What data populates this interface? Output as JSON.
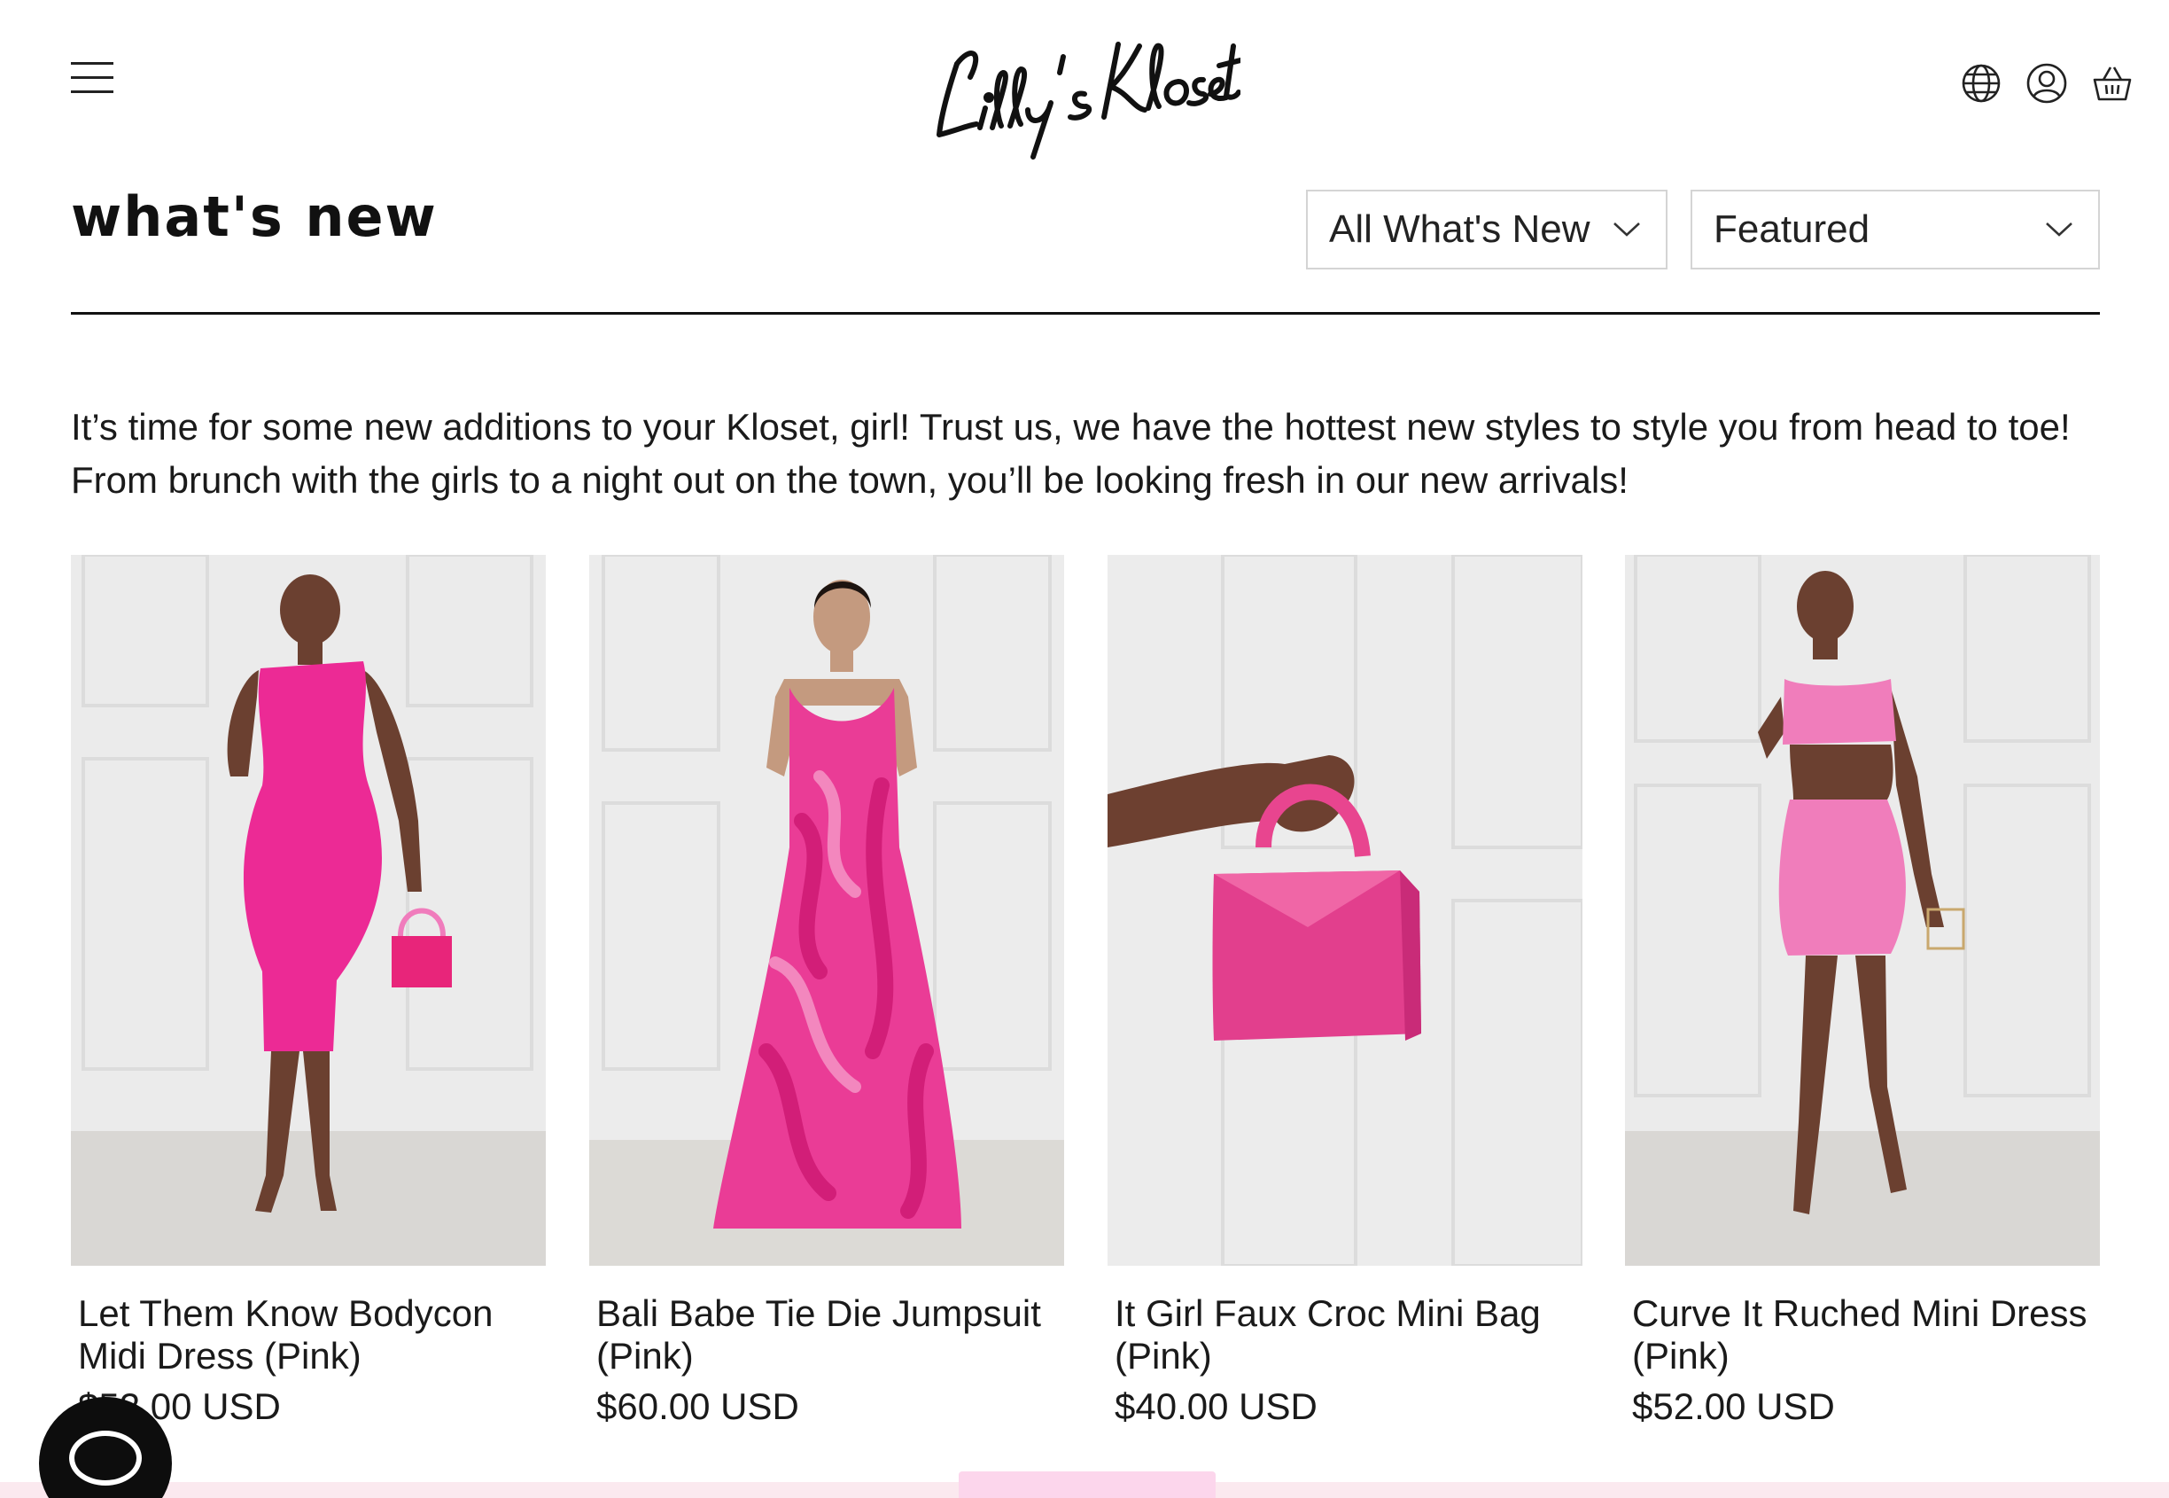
{
  "brand": {
    "logo_text": "Lilly's Kloset"
  },
  "header": {
    "menu_icon": "hamburger-menu-icon",
    "icons": [
      "globe-icon",
      "account-icon",
      "cart-icon"
    ]
  },
  "page": {
    "title": "what's new",
    "intro": "It’s time for some new additions to your Kloset, girl! Trust us, we have the hottest new styles to style you from head to toe! From brunch with the girls to a night out on the town, you’ll be looking fresh in our new arrivals!"
  },
  "filters": {
    "collection": {
      "selected": "All What's New"
    },
    "sort": {
      "selected": "Featured"
    }
  },
  "products": [
    {
      "name": "Let Them Know Bodycon Midi Dress (Pink)",
      "price": "$52.00 USD",
      "image": "model in hot pink bodycon midi dress"
    },
    {
      "name": "Bali Babe Tie Die Jumpsuit (Pink)",
      "price": "$60.00 USD",
      "image": "model in pink tie-dye jumpsuit"
    },
    {
      "name": "It Girl Faux Croc Mini Bag (Pink)",
      "price": "$40.00 USD",
      "image": "hand holding pink croc mini bag"
    },
    {
      "name": "Curve It Ruched Mini Dress (Pink)",
      "price": "$52.00 USD",
      "image": "model in pink ruched mini dress set"
    }
  ],
  "colors": {
    "accent_pink": "#ee2e9a",
    "bottom_banner": "#fcd6ec",
    "chat_button": "#0d0d0d"
  },
  "chat": {
    "icon": "chat-bubble-icon"
  }
}
